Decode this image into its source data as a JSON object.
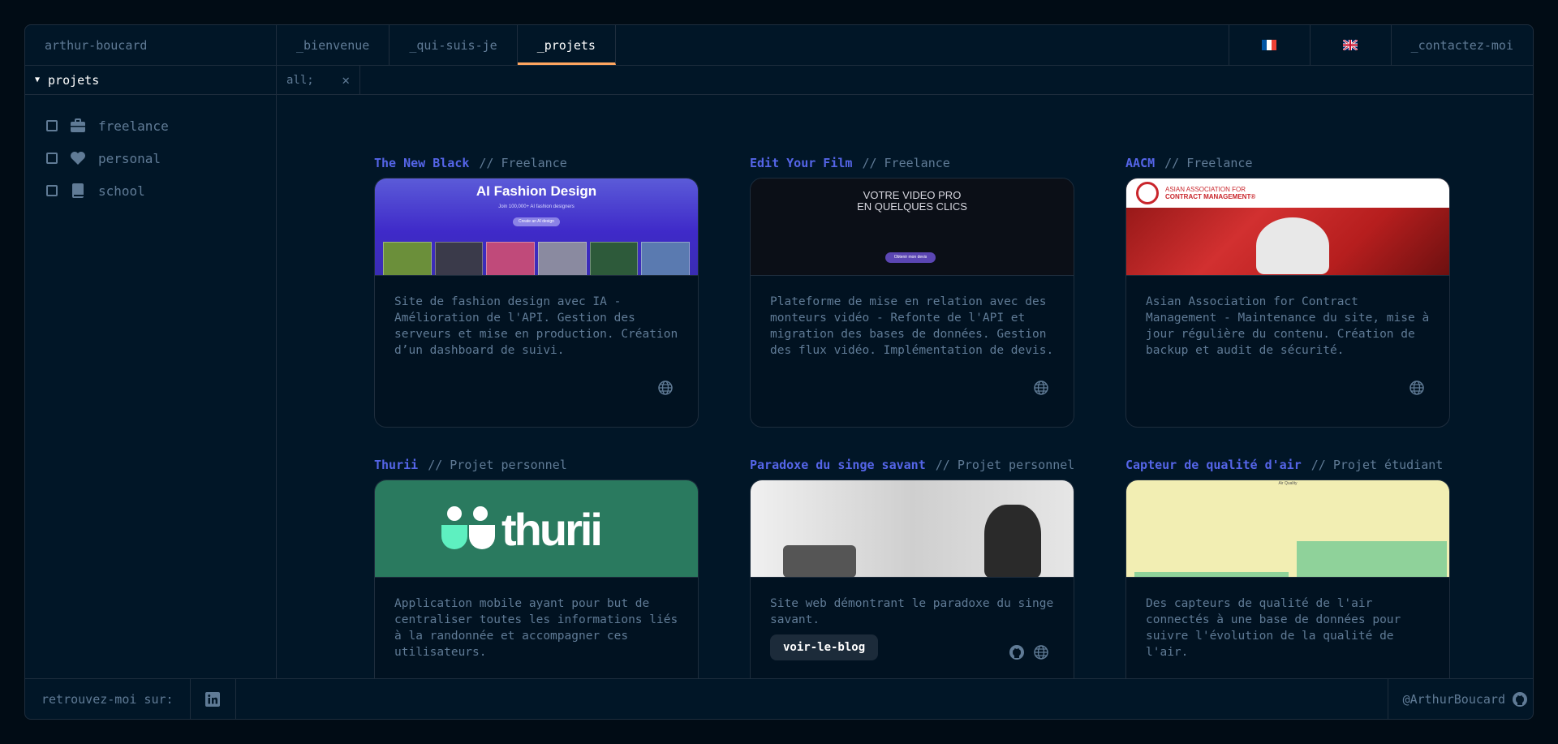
{
  "header": {
    "brand": "arthur-boucard",
    "tabs": [
      {
        "label": "_bienvenue"
      },
      {
        "label": "_qui-suis-je"
      },
      {
        "label": "_projets"
      }
    ],
    "contact": "_contactez-moi",
    "languages": [
      "fr",
      "en"
    ]
  },
  "sidebar": {
    "section": "projets",
    "filters": [
      {
        "label": "freelance",
        "icon": "briefcase-icon"
      },
      {
        "label": "personal",
        "icon": "heart-icon"
      },
      {
        "label": "school",
        "icon": "book-icon"
      }
    ]
  },
  "tabbar": {
    "active_filter": "all;"
  },
  "projects": [
    {
      "name": "The New Black",
      "type": "// Freelance",
      "description": "Site de fashion design avec IA - Amélioration de l'API. Gestion des serveurs et mise en production. Création d’un dashboard de suivi.",
      "thumb": {
        "title": "AI Fashion Design",
        "subtitle": "Join 100,000+ AI fashion designers",
        "button": "Create an AI design"
      }
    },
    {
      "name": "Edit Your Film",
      "type": "// Freelance",
      "description": "Plateforme de mise en relation avec des monteurs vidéo - Refonte de l'API et migration des bases de données. Gestion des flux vidéo. Implémentation de devis.",
      "thumb": {
        "title_line1": "VOTRE VIDEO PRO",
        "title_line2": "EN QUELQUES CLICS",
        "button": "Obtenir mon devis"
      }
    },
    {
      "name": "AACM",
      "type": "// Freelance",
      "description": "Asian Association for Contract Management - Maintenance du site, mise à jour régulière du contenu. Création de backup et audit de sécurité.",
      "thumb": {
        "line1": "ASIAN ASSOCIATION FOR",
        "line2": "CONTRACT MANAGEMENT®"
      }
    },
    {
      "name": "Thurii",
      "type": "// Projet personnel",
      "description": "Application mobile ayant pour but de centraliser toutes les informations liés à la randonnée et accompagner ces utilisateurs.",
      "thumb": {
        "word": "thurii"
      }
    },
    {
      "name": "Paradoxe du singe savant",
      "type": "// Projet personnel",
      "description": "Site web démontrant le paradoxe du singe savant.",
      "button": "voir-le-blog",
      "thumb": {}
    },
    {
      "name": "Capteur de qualité d'air",
      "type": "// Projet étudiant",
      "description": "Des capteurs de qualité de l'air connectés à une base de données pour suivre l'évolution de la qualité de l'air.",
      "thumb": {
        "title": "Air Quality"
      }
    }
  ],
  "footer": {
    "find_me": "retrouvez-moi sur:",
    "handle": "@ArthurBoucard"
  },
  "colors": {
    "background": "#010c15",
    "panel": "#011627",
    "border": "#1e2d3d",
    "accent": "#fea55f",
    "link": "#5565e8",
    "text": "#607b96"
  }
}
